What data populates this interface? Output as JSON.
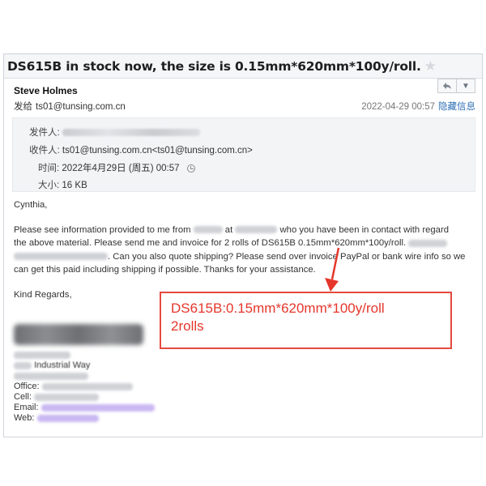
{
  "subject": "DS615B in stock now, the size is 0.15mm*620mm*100y/roll.",
  "sender": "Steve Holmes",
  "to_label": "发给",
  "to_address": "ts01@tunsing.com.cn",
  "date": "2022-04-29 00:57",
  "hide_details": "隐藏信息",
  "meta": {
    "from_label": "发件人:",
    "to_label": "收件人:",
    "to_value": "ts01@tunsing.com.cn<ts01@tunsing.com.cn>",
    "time_label": "时间:",
    "time_value": "2022年4月29日 (周五) 00:57",
    "size_label": "大小:",
    "size_value": "16 KB"
  },
  "body": {
    "greeting": "Cynthia,",
    "l1a": "Please see information provided to me from",
    "l1b": "at",
    "l1c": "who you have been in contact with regard",
    "l2": "the above material. Please send me and invoice for 2 rolls of DS615B 0.15mm*620mm*100y/roll.",
    "l3": ". Can you also quote shipping? Please send over invoice PayPal or bank wire info so we",
    "l4": "can get this paid including shipping if possible. Thanks for your assistance.",
    "closing": "Kind Regards,"
  },
  "signature": {
    "street": "Industrial Way",
    "office": "Office:",
    "cell": "Cell:",
    "email": "Email:",
    "web": "Web:"
  },
  "callout": {
    "line1": "DS615B:0.15mm*620mm*100y/roll",
    "line2": "2rolls"
  },
  "colors": {
    "accent_red": "#e5362c",
    "link_blue": "#2f6fb5"
  }
}
